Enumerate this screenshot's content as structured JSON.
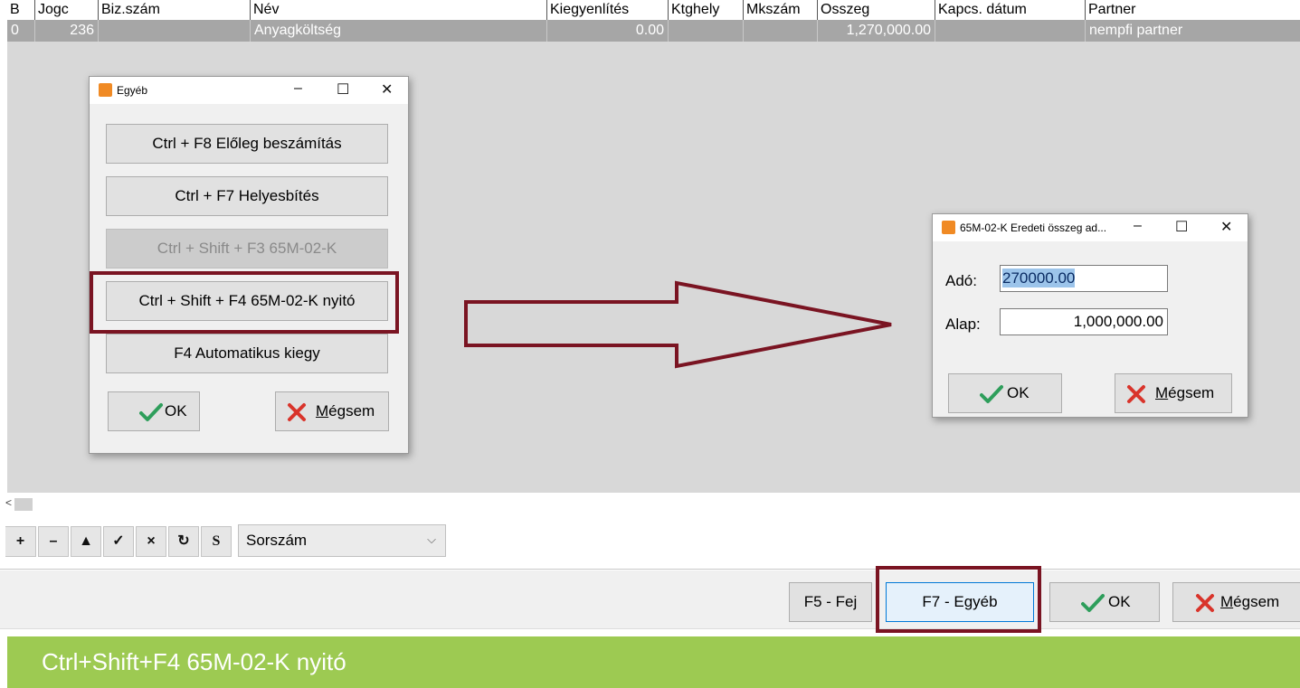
{
  "grid": {
    "headers": [
      "B",
      "Jogc",
      "Biz.szám",
      "Név",
      "Kiegyenlítés",
      "Ktghely",
      "Mkszám",
      "Osszeg",
      "Kapcs. dátum",
      "Partner"
    ],
    "row": {
      "b": "0",
      "jogc": "236",
      "bizszam": "",
      "nev": "Anyagköltség",
      "kiegyenlites": "0.00",
      "ktghely": "",
      "mkszam": "",
      "osszeg": "1,270,000.00",
      "kapcs_datum": "",
      "partner": "nempfi partner"
    },
    "scroll_left_tick": "<"
  },
  "nav": {
    "buttons": [
      "+",
      "–",
      "▲",
      "✓",
      "×",
      "↻",
      "S"
    ],
    "sort_value": "Sorszám"
  },
  "bottom": {
    "f5": "F5 - Fej",
    "f7": "F7 - Egyéb",
    "ok": "OK",
    "cancel_underlined": "M",
    "cancel_rest": "égsem"
  },
  "egyeb_dialog": {
    "title": "Egyéb",
    "buttons": [
      "Ctrl + F8 Előleg beszámítás",
      "Ctrl + F7 Helyesbítés",
      "Ctrl + Shift + F3 65M-02-K",
      "Ctrl + Shift + F4 65M-02-K nyitó",
      "F4 Automatikus kiegy"
    ],
    "ok": "OK",
    "cancel_underlined": "M",
    "cancel_rest": "égsem"
  },
  "amount_dialog": {
    "title": "65M-02-K Eredeti összeg ad...",
    "ado_label": "Adó:",
    "ado_value": "270000.00",
    "alap_label": "Alap:",
    "alap_value": "1,000,000.00",
    "ok": "OK",
    "cancel_underlined": "M",
    "cancel_rest": "égsem"
  },
  "window_controls": {
    "minimize": "–",
    "maximize": "☐",
    "close": "✕"
  },
  "caption": "Ctrl+Shift+F4 65M-02-K nyitó",
  "colors": {
    "highlight": "#7a1422",
    "caption_bg": "#9dca52",
    "ok_green": "#2e9e5b",
    "cancel_red": "#d9342b",
    "selected_row": "#a6a6a6"
  }
}
